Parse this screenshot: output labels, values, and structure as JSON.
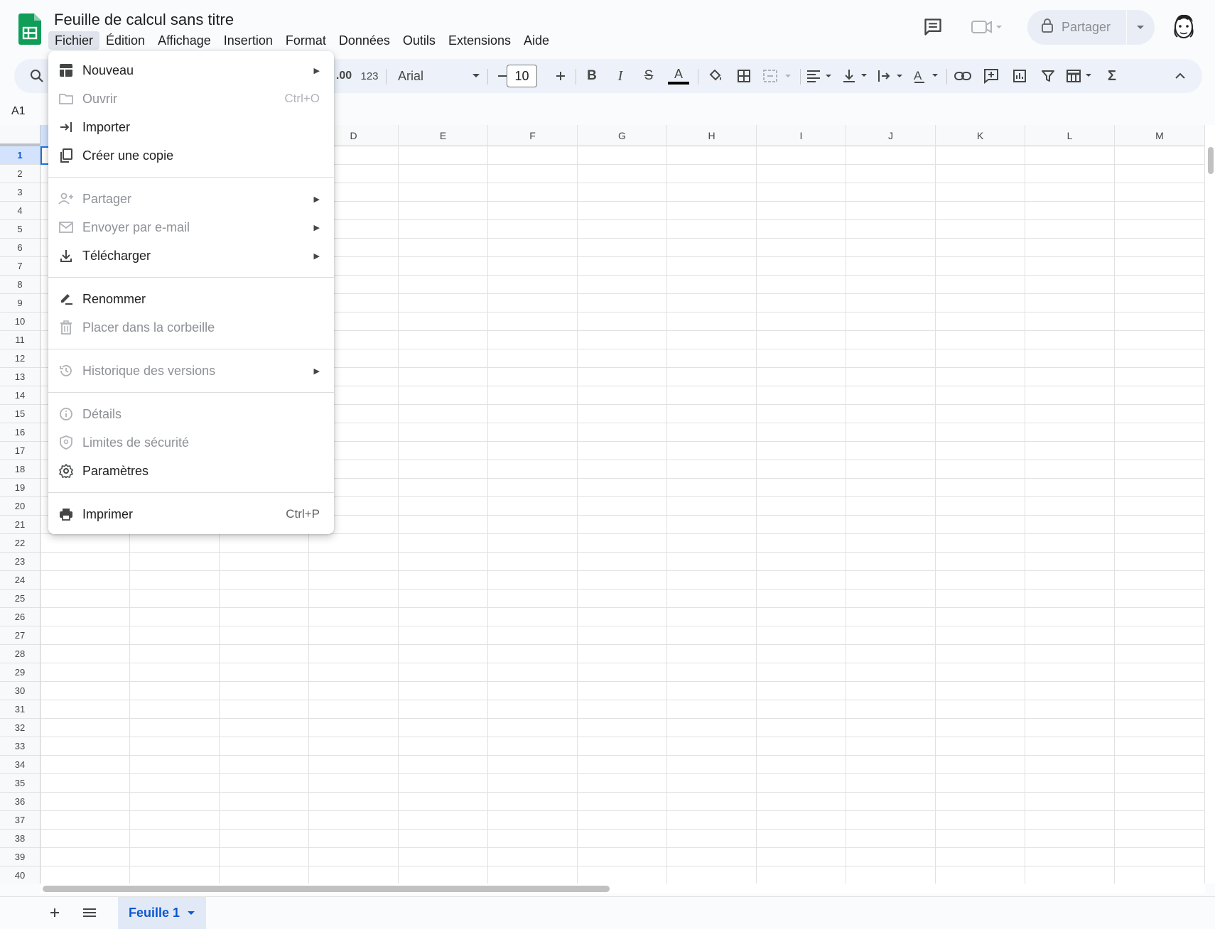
{
  "document": {
    "title": "Feuille de calcul sans titre"
  },
  "menubar": [
    {
      "label": "Fichier",
      "active": true
    },
    {
      "label": "Édition"
    },
    {
      "label": "Affichage"
    },
    {
      "label": "Insertion"
    },
    {
      "label": "Format"
    },
    {
      "label": "Données"
    },
    {
      "label": "Outils"
    },
    {
      "label": "Extensions"
    },
    {
      "label": "Aide"
    }
  ],
  "header": {
    "share_label": "Partager",
    "icons": [
      "comment-icon",
      "video-call-icon",
      "lock-icon",
      "chevron-down-icon",
      "avatar"
    ]
  },
  "toolbar": {
    "number_format_label": "123",
    "font_name": "Arial",
    "font_size": "10",
    "icons": [
      "search-icon",
      "decimal-increase-icon",
      "font-dropdown",
      "decrease-size-icon",
      "increase-size-icon",
      "bold-icon",
      "italic-icon",
      "strikethrough-icon",
      "text-color-icon",
      "fill-color-icon",
      "borders-icon",
      "merge-cells-icon",
      "align-icon",
      "valign-icon",
      "wrap-icon",
      "rotate-icon",
      "link-icon",
      "comment-add-icon",
      "chart-icon",
      "filter-icon",
      "table-view-icon",
      "functions-icon",
      "collapse-icon"
    ]
  },
  "namebox": {
    "value": "A1"
  },
  "grid": {
    "columns": [
      "D",
      "E",
      "F",
      "G",
      "H",
      "I",
      "J",
      "K",
      "L",
      "M"
    ],
    "rows": [
      "1",
      "2",
      "3",
      "4",
      "5",
      "6",
      "7",
      "8",
      "9",
      "10",
      "11",
      "12",
      "13",
      "14",
      "15",
      "16",
      "17",
      "18",
      "19",
      "20",
      "21",
      "22",
      "23",
      "24",
      "25",
      "26",
      "27",
      "28",
      "29",
      "30",
      "31",
      "32",
      "33",
      "34",
      "35",
      "36",
      "37",
      "38",
      "39",
      "40"
    ],
    "selected_row": "1"
  },
  "file_menu": {
    "items": [
      {
        "label": "Nouveau",
        "icon": "new-sheet-icon",
        "submenu": true,
        "disabled": false
      },
      {
        "label": "Ouvrir",
        "icon": "folder-icon",
        "shortcut": "Ctrl+O",
        "disabled": true
      },
      {
        "label": "Importer",
        "icon": "import-icon",
        "disabled": false
      },
      {
        "label": "Créer une copie",
        "icon": "copy-icon",
        "disabled": false
      },
      {
        "label": "Partager",
        "icon": "person-add-icon",
        "submenu": true,
        "disabled": true
      },
      {
        "label": "Envoyer par e-mail",
        "icon": "mail-icon",
        "submenu": true,
        "disabled": true
      },
      {
        "label": "Télécharger",
        "icon": "download-icon",
        "submenu": true,
        "disabled": false
      },
      {
        "label": "Renommer",
        "icon": "rename-icon",
        "disabled": false
      },
      {
        "label": "Placer dans la corbeille",
        "icon": "trash-icon",
        "disabled": true
      },
      {
        "label": "Historique des versions",
        "icon": "history-icon",
        "submenu": true,
        "disabled": true
      },
      {
        "label": "Détails",
        "icon": "info-icon",
        "disabled": true
      },
      {
        "label": "Limites de sécurité",
        "icon": "security-icon",
        "disabled": true
      },
      {
        "label": "Paramètres",
        "icon": "gear-icon",
        "disabled": false
      },
      {
        "label": "Imprimer",
        "icon": "print-icon",
        "shortcut": "Ctrl+P",
        "disabled": false
      }
    ]
  },
  "sheets": [
    {
      "name": "Feuille 1",
      "active": true
    }
  ],
  "colors": {
    "brand_green": "#0f9d58",
    "selection_blue": "#1a73e8",
    "tab_active_text": "#0b57d0"
  }
}
